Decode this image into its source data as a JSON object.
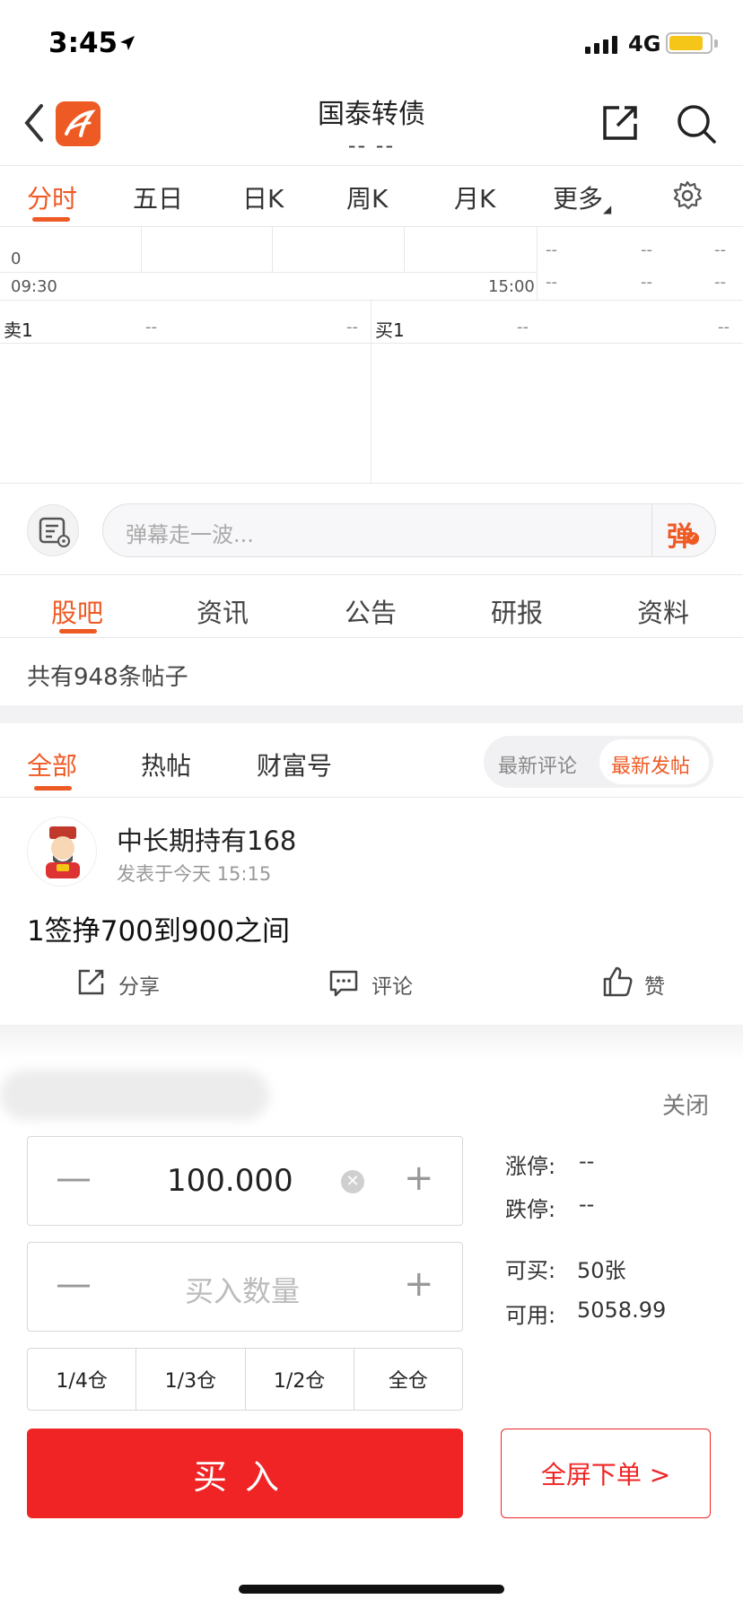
{
  "status_bar": {
    "time": "3:45",
    "network": "4G",
    "battery_level": 0.85,
    "battery_color": "#f5c518"
  },
  "header": {
    "title": "国泰转债",
    "subtitle": "-- --"
  },
  "chart_tabs": [
    "分时",
    "五日",
    "日K",
    "周K",
    "月K",
    "更多"
  ],
  "chart_info": {
    "zero_label": "0",
    "time_start": "09:30",
    "time_end": "15:00",
    "side_dash": "--"
  },
  "order_book": {
    "sell_label": "卖1",
    "buy_label": "买1",
    "dash": "--"
  },
  "danmu": {
    "placeholder": "弹幕走一波...",
    "send_label": "弹"
  },
  "content_tabs": [
    "股吧",
    "资讯",
    "公告",
    "研报",
    "资料"
  ],
  "post_count_text": "共有948条帖子",
  "filter_tabs": [
    "全部",
    "热帖",
    "财富号"
  ],
  "sort": {
    "option1": "最新评论",
    "option2": "最新发帖"
  },
  "post": {
    "author": "中长期持有168",
    "time": "发表于今天 15:15",
    "content": "1签挣700到900之间",
    "share_label": "分享",
    "comment_label": "评论",
    "like_label": "赞"
  },
  "trade_panel": {
    "close_label": "关闭",
    "price_value": "100.000",
    "quantity_placeholder": "买入数量",
    "limit_up_label": "涨停:",
    "limit_up_value": "--",
    "limit_down_label": "跌停:",
    "limit_down_value": "--",
    "can_buy_label": "可买:",
    "can_buy_value": "50张",
    "available_label": "可用:",
    "available_value": "5058.99",
    "positions": [
      "1/4仓",
      "1/3仓",
      "1/2仓",
      "全仓"
    ],
    "buy_label": "买入",
    "fullscreen_label": "全屏下单 >"
  },
  "colors": {
    "accent": "#ee5a24",
    "buy_red": "#f02424"
  }
}
